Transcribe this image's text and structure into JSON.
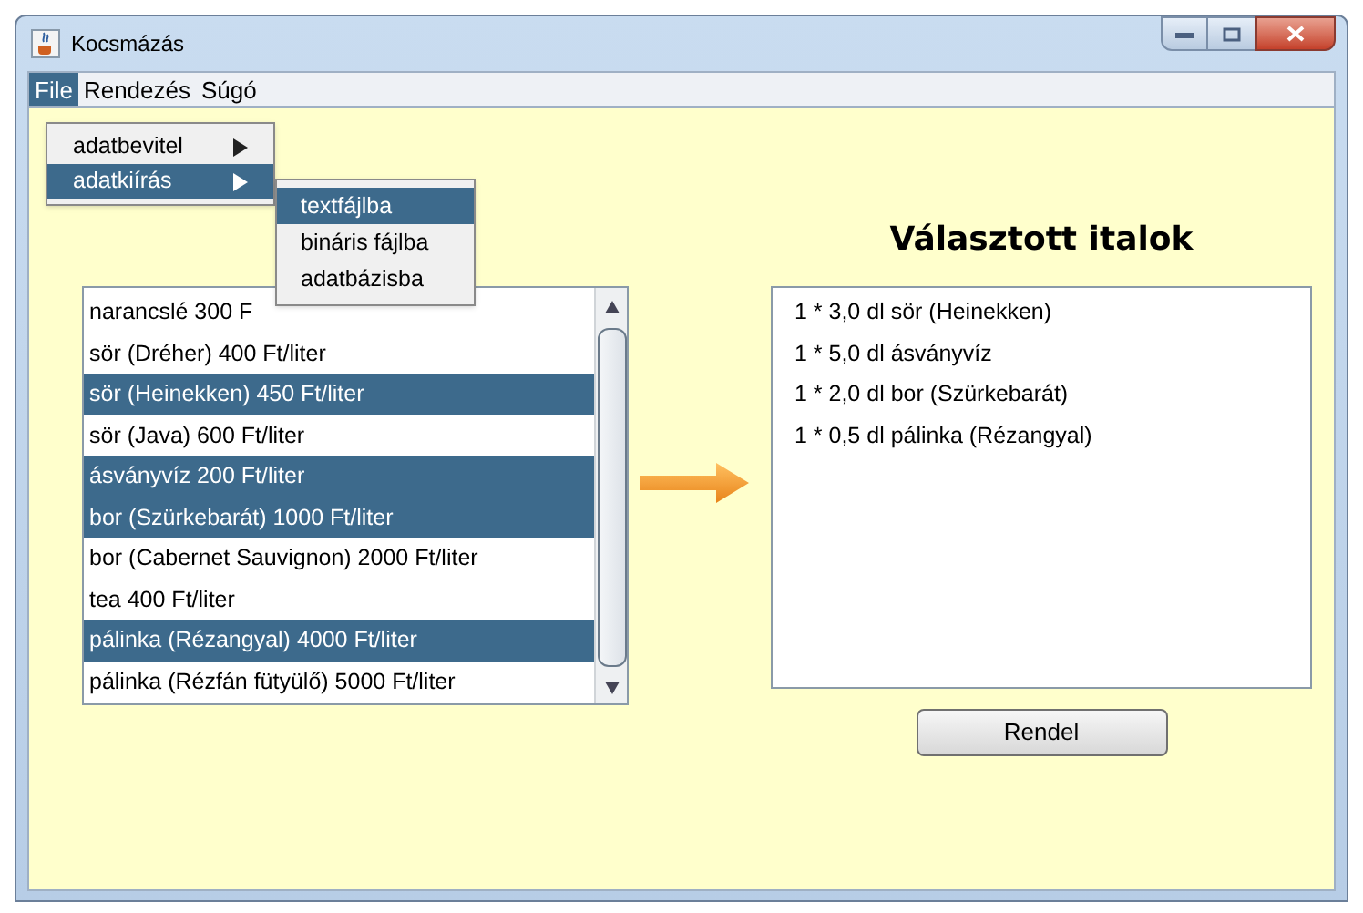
{
  "window": {
    "title": "Kocsmázás"
  },
  "menu_bar": [
    {
      "label": "File",
      "selected": true
    },
    {
      "label": "Rendezés",
      "selected": false
    },
    {
      "label": "Súgó",
      "selected": false
    }
  ],
  "file_menu": [
    {
      "label": "adatbevitel",
      "selected": false,
      "submenu": true
    },
    {
      "label": "adatkiírás",
      "selected": true,
      "submenu": true
    }
  ],
  "submenu": [
    {
      "label": "textfájlba",
      "selected": true
    },
    {
      "label": "bináris fájlba",
      "selected": false
    },
    {
      "label": "adatbázisba",
      "selected": false
    }
  ],
  "drinks": [
    {
      "label": "narancslé 300 F",
      "selected": false
    },
    {
      "label": "sör (Dréher)  400 Ft/liter",
      "selected": false
    },
    {
      "label": "sör (Heinekken)  450 Ft/liter",
      "selected": true
    },
    {
      "label": "sör (Java)  600 Ft/liter",
      "selected": false
    },
    {
      "label": "ásványvíz 200 Ft/liter",
      "selected": true
    },
    {
      "label": "bor (Szürkebarát) 1000 Ft/liter",
      "selected": true
    },
    {
      "label": "bor (Cabernet Sauvignon) 2000 Ft/liter",
      "selected": false
    },
    {
      "label": "tea 400 Ft/liter",
      "selected": false
    },
    {
      "label": "pálinka (Rézangyal) 4000 Ft/liter",
      "selected": true
    },
    {
      "label": "pálinka (Rézfán fütyülő) 5000 Ft/liter",
      "selected": false
    }
  ],
  "heading": "Választott italok",
  "chosen": [
    "1 * 3,0 dl sör (Heinekken)",
    "1 * 5,0 dl ásványvíz",
    "1 * 2,0 dl bor (Szürkebarát)",
    "1 * 0,5 dl pálinka (Rézangyal)"
  ],
  "order_button": "Rendel"
}
